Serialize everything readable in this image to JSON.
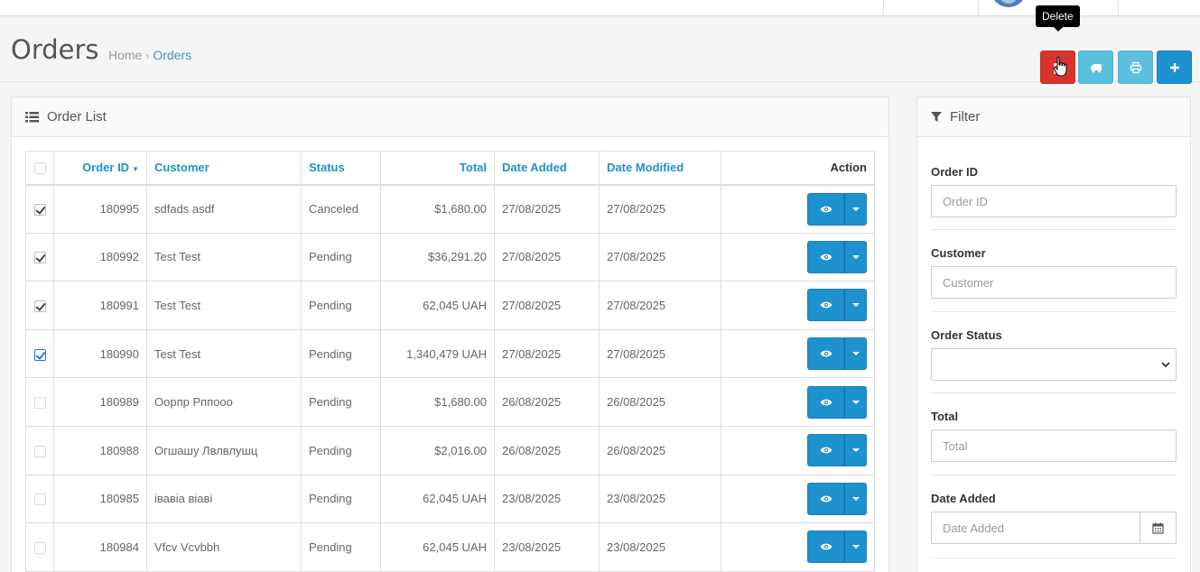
{
  "header": {
    "title": "Orders",
    "breadcrumb": [
      "Home",
      "Orders"
    ],
    "tooltip": "Delete",
    "buttons": [
      {
        "name": "delete-button",
        "icon": "trash-icon",
        "color": "#d9342b"
      },
      {
        "name": "shipping-button",
        "icon": "truck-icon",
        "color": "#5bc0de"
      },
      {
        "name": "print-button",
        "icon": "print-icon",
        "color": "#5bc0de"
      },
      {
        "name": "add-button",
        "icon": "plus-icon",
        "color": "#1e91cf"
      }
    ]
  },
  "order_list": {
    "title": "Order List",
    "columns": {
      "order_id": "Order ID",
      "customer": "Customer",
      "status": "Status",
      "total": "Total",
      "date_added": "Date Added",
      "date_modified": "Date Modified",
      "action": "Action"
    },
    "rows": [
      {
        "checked": true,
        "order_id": "180995",
        "customer": "sdfads asdf",
        "status": "Canceled",
        "total": "$1,680.00",
        "date_added": "27/08/2025",
        "date_modified": "27/08/2025"
      },
      {
        "checked": true,
        "order_id": "180992",
        "customer": "Test Test",
        "status": "Pending",
        "total": "$36,291.20",
        "date_added": "27/08/2025",
        "date_modified": "27/08/2025"
      },
      {
        "checked": true,
        "order_id": "180991",
        "customer": "Test Test",
        "status": "Pending",
        "total": "62,045 UAH",
        "date_added": "27/08/2025",
        "date_modified": "27/08/2025"
      },
      {
        "checked": true,
        "order_id": "180990",
        "customer": "Test Test",
        "status": "Pending",
        "total": "1,340,479 UAH",
        "date_added": "27/08/2025",
        "date_modified": "27/08/2025"
      },
      {
        "checked": false,
        "order_id": "180989",
        "customer": "Оорпр Рппооо",
        "status": "Pending",
        "total": "$1,680.00",
        "date_added": "26/08/2025",
        "date_modified": "26/08/2025"
      },
      {
        "checked": false,
        "order_id": "180988",
        "customer": "Огшашу Лвлвлушц",
        "status": "Pending",
        "total": "$2,016.00",
        "date_added": "26/08/2025",
        "date_modified": "26/08/2025"
      },
      {
        "checked": false,
        "order_id": "180985",
        "customer": "івавіа віаві",
        "status": "Pending",
        "total": "62,045 UAH",
        "date_added": "23/08/2025",
        "date_modified": "23/08/2025"
      },
      {
        "checked": false,
        "order_id": "180984",
        "customer": "Vfcv Vcvbbh",
        "status": "Pending",
        "total": "62,045 UAH",
        "date_added": "23/08/2025",
        "date_modified": "23/08/2025"
      }
    ]
  },
  "filter": {
    "title": "Filter",
    "order_id": {
      "label": "Order ID",
      "placeholder": "Order ID"
    },
    "customer": {
      "label": "Customer",
      "placeholder": "Customer"
    },
    "order_status": {
      "label": "Order Status",
      "value": ""
    },
    "total": {
      "label": "Total",
      "placeholder": "Total"
    },
    "date_added": {
      "label": "Date Added",
      "placeholder": "Date Added"
    }
  }
}
